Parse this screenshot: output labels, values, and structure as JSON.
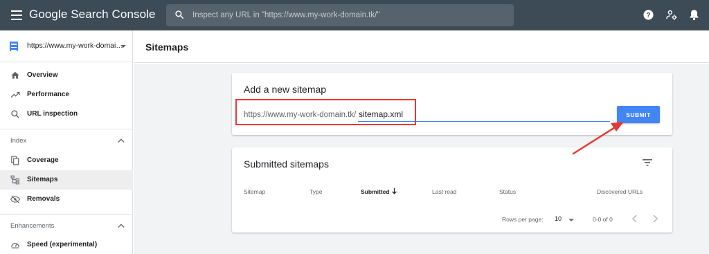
{
  "header": {
    "app_title": "Google Search Console",
    "search_placeholder": "Inspect any URL in \"https://www.my-work-domain.tk/\""
  },
  "sidebar": {
    "property": "https://www.my-work-domai…",
    "items": [
      {
        "label": "Overview",
        "icon": "home-icon"
      },
      {
        "label": "Performance",
        "icon": "trending-up-icon"
      },
      {
        "label": "URL inspection",
        "icon": "search-icon"
      }
    ],
    "sections": [
      {
        "label": "Index",
        "items": [
          {
            "label": "Coverage",
            "icon": "coverage-icon"
          },
          {
            "label": "Sitemaps",
            "icon": "sitemap-icon",
            "active": true
          },
          {
            "label": "Removals",
            "icon": "eye-off-icon"
          }
        ]
      },
      {
        "label": "Enhancements",
        "items": [
          {
            "label": "Speed (experimental)",
            "icon": "speedometer-icon"
          }
        ]
      }
    ]
  },
  "main": {
    "page_title": "Sitemaps",
    "add_card": {
      "title": "Add a new sitemap",
      "url_prefix": "https://www.my-work-domain.tk/",
      "input_value": "sitemap.xml",
      "submit_label": "SUBMIT"
    },
    "submitted_card": {
      "title": "Submitted sitemaps",
      "columns": [
        "Sitemap",
        "Type",
        "Submitted",
        "Last read",
        "Status",
        "Discovered URLs"
      ],
      "sorted_column": "Submitted",
      "rows_per_page_label": "Rows per page:",
      "rows_per_page_value": "10",
      "range_label": "0-0 of 0"
    }
  },
  "annotation": {
    "highlight_color": "#e53935"
  },
  "colors": {
    "topbar": "#3c4b56",
    "accent": "#4285f4"
  }
}
